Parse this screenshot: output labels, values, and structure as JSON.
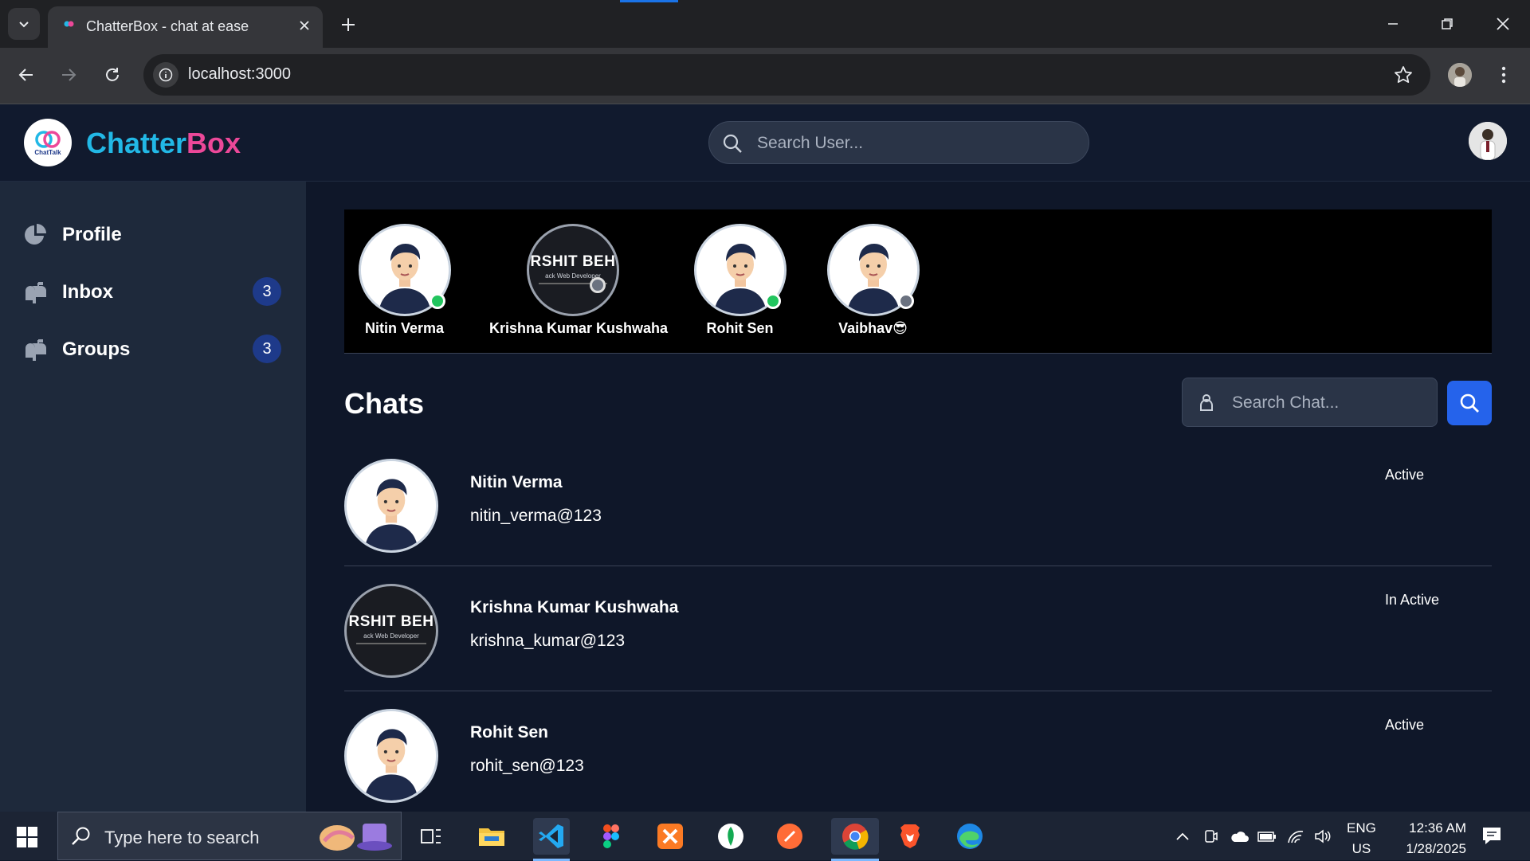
{
  "browser": {
    "tab_title": "ChatterBox - chat at ease",
    "url": "localhost:3000"
  },
  "header": {
    "brand_part1": "Chatter",
    "brand_part2": "Box",
    "logo_caption": "ChatTalk",
    "search_placeholder": "Search User..."
  },
  "sidebar": {
    "items": [
      {
        "label": "Profile",
        "icon": "pie-chart-icon",
        "badge": ""
      },
      {
        "label": "Inbox",
        "icon": "mailbox-icon",
        "badge": "3"
      },
      {
        "label": "Groups",
        "icon": "mailbox-icon",
        "badge": "3"
      }
    ]
  },
  "stories": [
    {
      "name": "Nitin Verma",
      "status": "online",
      "avatar": "cartoon"
    },
    {
      "name": "Krishna Kumar Kushwaha",
      "status": "offline",
      "avatar": "banner"
    },
    {
      "name": "Rohit Sen",
      "status": "online",
      "avatar": "cartoon"
    },
    {
      "name": "Vaibhav😎",
      "status": "offline",
      "avatar": "cartoon"
    }
  ],
  "banner": {
    "big": "RSHIT BEH",
    "small": "ack Web Developer"
  },
  "chats": {
    "title": "Chats",
    "search_placeholder": "Search Chat...",
    "rows": [
      {
        "name": "Nitin Verma",
        "username": "nitin_verma@123",
        "status": "Active",
        "avatar": "cartoon"
      },
      {
        "name": "Krishna Kumar Kushwaha",
        "username": "krishna_kumar@123",
        "status": "In Active",
        "avatar": "banner"
      },
      {
        "name": "Rohit Sen",
        "username": "rohit_sen@123",
        "status": "Active",
        "avatar": "cartoon"
      }
    ]
  },
  "taskbar": {
    "search_text": "Type here to search",
    "lang_top": "ENG",
    "lang_bottom": "US",
    "time": "12:36 AM",
    "date": "1/28/2025"
  },
  "colors": {
    "brand_cyan": "#22b8e6",
    "brand_pink": "#ec4899",
    "accent_blue": "#2563eb",
    "online": "#22c55e",
    "offline": "#6b7280"
  }
}
